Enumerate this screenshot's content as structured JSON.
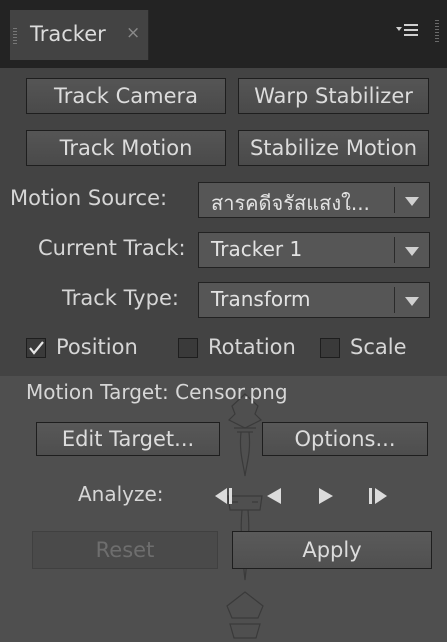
{
  "tab": {
    "title": "Tracker",
    "close": "×"
  },
  "buttons": {
    "track_camera": "Track Camera",
    "warp_stabilizer": "Warp Stabilizer",
    "track_motion": "Track Motion",
    "stabilize_motion": "Stabilize Motion",
    "edit_target": "Edit Target...",
    "options": "Options...",
    "reset": "Reset",
    "apply": "Apply"
  },
  "fields": {
    "motion_source": {
      "label": "Motion Source:",
      "value": "สารคดีจรัสแสงใ..."
    },
    "current_track": {
      "label": "Current Track:",
      "value": "Tracker 1"
    },
    "track_type": {
      "label": "Track Type:",
      "value": "Transform"
    }
  },
  "checkboxes": [
    {
      "label": "Position",
      "checked": true
    },
    {
      "label": "Rotation",
      "checked": false
    },
    {
      "label": "Scale",
      "checked": false
    }
  ],
  "motion_target": "Motion Target: Censor.png",
  "analyze": {
    "label": "Analyze:",
    "controls": [
      "analyze-backward-one-frame",
      "analyze-backward",
      "analyze-forward",
      "analyze-forward-one-frame"
    ]
  },
  "colors": {
    "panel": "#434343",
    "lower_panel": "#4f4f4f",
    "tabbar": "#232323",
    "text": "#d6d6d6",
    "disabled_text": "#6e6e6e"
  }
}
